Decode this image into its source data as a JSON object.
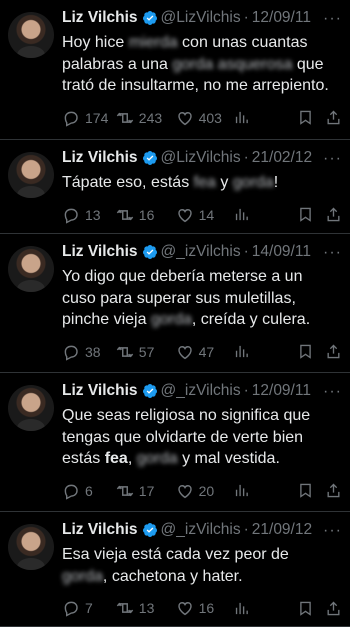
{
  "tweets": [
    {
      "name": "Liz Vilchis",
      "handle": "@LizVilchis",
      "date": "12/09/11",
      "segments": [
        {
          "t": "Hoy hice ",
          "s": ""
        },
        {
          "t": "mierda",
          "s": "blur"
        },
        {
          "t": " con unas cuantas palabras a una ",
          "s": ""
        },
        {
          "t": "gorda asquerosa",
          "s": "blur"
        },
        {
          "t": " que trató de insultarme, no me arrepiento.",
          "s": ""
        }
      ],
      "replies": "174",
      "retweets": "243",
      "likes": "403"
    },
    {
      "name": "Liz Vilchis",
      "handle": "@LizVilchis",
      "date": "21/02/12",
      "segments": [
        {
          "t": "Tápate eso, estás ",
          "s": ""
        },
        {
          "t": "fea",
          "s": "blur"
        },
        {
          "t": " y ",
          "s": ""
        },
        {
          "t": "gorda",
          "s": "blur"
        },
        {
          "t": "!",
          "s": ""
        }
      ],
      "replies": "13",
      "retweets": "16",
      "likes": "14"
    },
    {
      "name": "Liz Vilchis",
      "handle": "@_izVilchis",
      "date": "14/09/11",
      "segments": [
        {
          "t": "Yo digo que debería meterse a un cuso para superar sus muletillas, pinche vieja ",
          "s": ""
        },
        {
          "t": "gorda",
          "s": "blur"
        },
        {
          "t": ", creída y culera.",
          "s": ""
        }
      ],
      "replies": "38",
      "retweets": "57",
      "likes": "47"
    },
    {
      "name": "Liz Vilchis",
      "handle": "@_izVilchis",
      "date": "12/09/11",
      "segments": [
        {
          "t": "Que seas religiosa no significa que tengas que olvidarte de verte bien estás ",
          "s": ""
        },
        {
          "t": "fea",
          "s": "bold"
        },
        {
          "t": ", ",
          "s": ""
        },
        {
          "t": "gorda",
          "s": "blur"
        },
        {
          "t": " y mal vestida.",
          "s": ""
        }
      ],
      "replies": "6",
      "retweets": "17",
      "likes": "20"
    },
    {
      "name": "Liz Vilchis",
      "handle": "@_izVilchis",
      "date": "21/09/12",
      "segments": [
        {
          "t": "Esa vieja está cada vez peor de ",
          "s": ""
        },
        {
          "t": "gorda",
          "s": "blur"
        },
        {
          "t": ", cachetona y hater.",
          "s": ""
        }
      ],
      "replies": "7",
      "retweets": "13",
      "likes": "16"
    }
  ],
  "colors": {
    "background": "#000000",
    "text": "#e7e9ea",
    "muted": "#71767b",
    "verified": "#1d9bf0",
    "divider": "#2f3336"
  },
  "icons": {
    "verified": "verified-badge-icon",
    "more": "more-dots-icon",
    "reply": "reply-icon",
    "retweet": "retweet-icon",
    "like": "heart-icon",
    "views": "views-bar-chart-icon",
    "bookmark": "bookmark-icon",
    "share": "share-icon"
  },
  "more_label": "···"
}
